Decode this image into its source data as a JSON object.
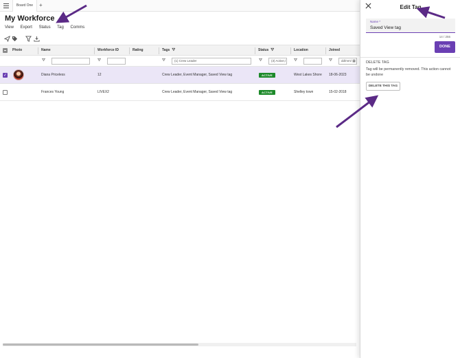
{
  "tabbar": {
    "tab_label": "Board One",
    "add_label": "+"
  },
  "page": {
    "title": "My Workforce"
  },
  "menu": [
    "View",
    "Export",
    "Status",
    "Tag",
    "Comms"
  ],
  "table": {
    "columns": [
      "Photo",
      "Name",
      "Workforce ID",
      "Rating",
      "Tags",
      "Status",
      "Location",
      "Joined"
    ],
    "filters": {
      "tags": "(1) Crew Leader",
      "status": "(3) Active,/",
      "joined": "dd/mm/"
    },
    "rows": [
      {
        "name": "Diana Priceless",
        "workforce_id": "12",
        "rating": "",
        "tags": "Crew Leader, Event Manager, Saved View tag",
        "status": "ACTIVE",
        "location": "West Lakes Shore",
        "joined": "18-06-2023",
        "selected": true
      },
      {
        "name": "Frances Young",
        "workforce_id": "LIVEX2",
        "rating": "",
        "tags": "Crew Leader, Event Manager, Saved View tag",
        "status": "ACTIVE",
        "location": "Shelley town",
        "joined": "15-02-2018",
        "selected": false
      }
    ]
  },
  "panel": {
    "title": "Edit Tag",
    "name_label": "Name *",
    "name_value": "Saved View tag",
    "char_count": "14 / 255",
    "done_label": "DONE",
    "delete_heading": "DELETE TAG",
    "delete_message": "Tag will be permanently removed. This action cannot be undone",
    "delete_button": "DELETE THIS TAG"
  },
  "colors": {
    "accent": "#6a3fb3",
    "arrow": "#5b2a86",
    "status_active": "#1d8a2a",
    "selected_row": "#ebe6f7"
  },
  "icons": [
    "menu-icon",
    "send-icon",
    "tag-icon",
    "filter-icon",
    "download-icon",
    "funnel-icon",
    "calendar-icon",
    "close-icon"
  ]
}
